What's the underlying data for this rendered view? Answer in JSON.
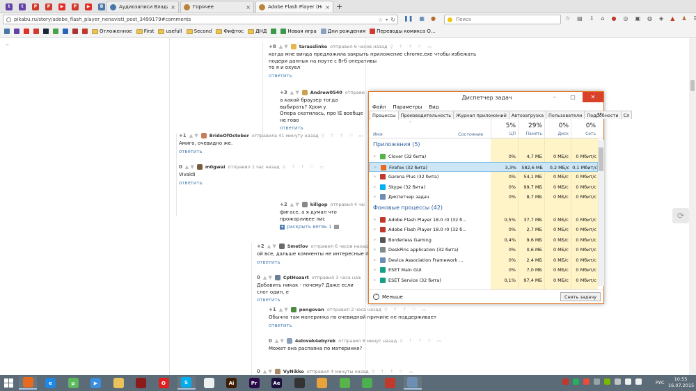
{
  "browser": {
    "pinned_tabs": [
      {
        "icon": "twitch-icon",
        "color": "#6441a5",
        "glyph": "t"
      },
      {
        "icon": "twitch-icon",
        "color": "#6441a5",
        "glyph": "t"
      },
      {
        "icon": "pikabu-icon",
        "color": "#d13b2f",
        "glyph": "P"
      },
      {
        "icon": "pikabu-icon",
        "color": "#d13b2f",
        "glyph": "P"
      },
      {
        "icon": "youtube-icon",
        "color": "#e52d27",
        "glyph": "▶"
      },
      {
        "icon": "pikabu-icon",
        "color": "#d13b2f",
        "glyph": "P"
      },
      {
        "icon": "youtube-icon",
        "color": "#e52d27",
        "glyph": "▶"
      },
      {
        "icon": "vk-icon",
        "color": "#4a76a8",
        "glyph": "В"
      }
    ],
    "tabs": [
      {
        "title": "Аудиозаписи Влада Перш...",
        "icon": "vk-icon",
        "color": "#4a76a8"
      },
      {
        "title": "Горячее",
        "icon": "pikabu-icon",
        "color": "#b9833a"
      },
      {
        "title": "Adobe Flash Player (Ненав...",
        "icon": "pikabu-icon",
        "color": "#b9833a"
      }
    ],
    "new_tab": "+",
    "close": "×",
    "url": "pikabu.ru/story/adobe_flash_player_nenavisti_post_3499179#comments",
    "search_placeholder": "Поиск",
    "bookmarks": [
      {
        "label": "",
        "icon": "vk-bookmark-icon",
        "color": "#4a76a8"
      },
      {
        "label": "",
        "icon": "twitch-bookmark-icon",
        "color": "#6441a5"
      },
      {
        "label": "",
        "icon": "youtube-bookmark-icon",
        "color": "#e52d27"
      },
      {
        "label": "",
        "icon": "pikabu-bookmark-icon",
        "color": "#d13b2f"
      },
      {
        "label": "",
        "icon": "steam-bookmark-icon",
        "color": "#1b2838"
      },
      {
        "label": "",
        "icon": "green-bookmark-icon",
        "color": "#4aa34a"
      },
      {
        "label": "",
        "icon": "mail-bookmark-icon",
        "color": "#2a63b8"
      },
      {
        "label": "",
        "icon": "game-bookmark-icon",
        "color": "#a33"
      },
      {
        "label": "",
        "icon": "red-bookmark-icon",
        "color": "#c0392b"
      },
      {
        "label": "Отложенное",
        "icon": "folder-icon"
      },
      {
        "label": "First",
        "icon": "folder-icon"
      },
      {
        "label": "usefull",
        "icon": "folder-icon"
      },
      {
        "label": "Second",
        "icon": "folder-icon"
      },
      {
        "label": "Фифтос",
        "icon": "folder-icon"
      },
      {
        "label": "ДНД",
        "icon": "folder-icon"
      },
      {
        "label": "",
        "icon": "green-grid-bookmark-icon",
        "color": "#3b9a4a"
      },
      {
        "label": "Новая игра",
        "icon": "green-grid-bookmark-icon",
        "color": "#3b9a4a"
      },
      {
        "label": "Дни рождения",
        "icon": "page-bookmark-icon",
        "color": "#8aa2c2"
      },
      {
        "label": "Переводы комикса О...",
        "icon": "pikabu-bookmark-icon",
        "color": "#d13b2f"
      }
    ]
  },
  "comments": [
    {
      "rating": "+8",
      "nick": "tarasslinko",
      "meta": "отправил 6 часов назад",
      "text": [
        "когда мне винда предложила закрыть приложение chrome.exe чтобы избежать",
        "подери данных на ноуте с 8гб оперативы",
        "то я и охуел"
      ],
      "reply": "ответить"
    },
    {
      "rating": "+3",
      "nick": "Andrew0540",
      "meta": "отправил 1 час н",
      "text": [
        "а какой браузер тогда выбирать? Хром у",
        "Опера скатилась, про IE вообще не гово"
      ],
      "reply": "ответить"
    },
    {
      "rating": "+1",
      "nick": "BrideOfOctober",
      "meta": "отправила 41 минуту назад",
      "text": [
        "Амиго, очевидно же."
      ],
      "reply": "ответить"
    },
    {
      "rating": "0",
      "nick": "m0gwai",
      "meta": "отправил 1 час назад",
      "text": [
        "Vivaldi"
      ],
      "reply": "ответить"
    },
    {
      "rating": "+2",
      "nick": "killgop",
      "meta": "отправил 4 часа назад",
      "text": [
        "фигасе, а я думал что прожорливее лис"
      ],
      "reply": "раскрыть ветвь 1"
    },
    {
      "rating": "+2",
      "nick": "Smetlov",
      "meta": "отправил 6 часов назад",
      "text": [
        "ой все, дальше комменты не интересные пошли."
      ],
      "reply": "ответить"
    },
    {
      "rating": "0",
      "nick": "CptHozart",
      "meta": "отправил 3 часа назад",
      "text": [
        "Добавить никак - почему? Даже если слот один, е"
      ],
      "reply": "ответить"
    },
    {
      "rating": "+1",
      "nick": "pengovan",
      "meta": "отправил 2 часа назад",
      "text": [
        "Обычно там материнка по очевидной причине не поддерживает"
      ],
      "reply": "ответить"
    },
    {
      "rating": "0",
      "nick": "4elovek4ebyrek",
      "meta": "отправил 8 минут назад",
      "text": [
        "Может она распаяна по материнке?"
      ],
      "reply": ""
    },
    {
      "rating": "0",
      "nick": "VyNikko",
      "meta": "отправил 4 минуты назад",
      "text": [],
      "reply": ""
    }
  ],
  "task_manager": {
    "title": "Диспетчер задач",
    "menu": [
      "Файл",
      "Параметры",
      "Вид"
    ],
    "tabs": [
      "Процессы",
      "Производительность",
      "Журнал приложений",
      "Автозагрузка",
      "Пользователи",
      "Подробности",
      "Сл"
    ],
    "columns": {
      "name": "Имя",
      "status": "Состояние",
      "cpu": {
        "pct": "5%",
        "label": "ЦП"
      },
      "mem": {
        "pct": "29%",
        "label": "Память"
      },
      "disk": {
        "pct": "0%",
        "label": "Диск"
      },
      "net": {
        "pct": "0%",
        "label": "Сеть"
      }
    },
    "groups": [
      {
        "title": "Приложения (5)",
        "rows": [
          {
            "name": "Clover (32 бита)",
            "icon": "clover-icon",
            "color": "#58b44a",
            "cpu": "0%",
            "mem": "4,7 МБ",
            "disk": "0 МБ/с",
            "net": "0 Мбит/с"
          },
          {
            "name": "Firefox (32 бита)",
            "icon": "firefox-icon",
            "color": "#e66a1f",
            "cpu": "3,3%",
            "mem": "582,6 МБ",
            "disk": "0,2 МБ/с",
            "net": "0,1 Мбит/с",
            "selected": true
          },
          {
            "name": "Garena Plus (32 бита)",
            "icon": "garena-icon",
            "color": "#c0392b",
            "cpu": "0%",
            "mem": "54,1 МБ",
            "disk": "0 МБ/с",
            "net": "0 Мбит/с"
          },
          {
            "name": "Skype (32 бита)",
            "icon": "skype-icon",
            "color": "#00aff0",
            "cpu": "0%",
            "mem": "99,7 МБ",
            "disk": "0 МБ/с",
            "net": "0 Мбит/с"
          },
          {
            "name": "Диспетчер задач",
            "icon": "taskmgr-icon",
            "color": "#6d8fb3",
            "cpu": "0%",
            "mem": "8,7 МБ",
            "disk": "0 МБ/с",
            "net": "0 Мбит/с"
          }
        ]
      },
      {
        "title": "Фоновые процессы (42)",
        "rows": [
          {
            "name": "Adobe Flash Player 18.0 r0 (32 б...",
            "icon": "flash-icon",
            "color": "#c0392b",
            "cpu": "0,5%",
            "mem": "37,7 МБ",
            "disk": "0 МБ/с",
            "net": "0 Мбит/с"
          },
          {
            "name": "Adobe Flash Player 18.0 r0 (32 б...",
            "icon": "flash-icon",
            "color": "#c0392b",
            "cpu": "0%",
            "mem": "2,7 МБ",
            "disk": "0 МБ/с",
            "net": "0 Мбит/с"
          },
          {
            "name": "Borderless Gaming",
            "icon": "gaming-icon",
            "color": "#555555",
            "cpu": "0,4%",
            "mem": "9,6 МБ",
            "disk": "0 МБ/с",
            "net": "0 Мбит/с"
          },
          {
            "name": "DeskPins application (32 бита)",
            "icon": "pin-icon",
            "color": "#7f8c8d",
            "cpu": "0%",
            "mem": "0,6 МБ",
            "disk": "0 МБ/с",
            "net": "0 Мбит/с"
          },
          {
            "name": "Device Association Framework ...",
            "icon": "device-icon",
            "color": "#6d8fb3",
            "cpu": "0%",
            "mem": "2,4 МБ",
            "disk": "0 МБ/с",
            "net": "0 Мбит/с"
          },
          {
            "name": "ESET Main GUI",
            "icon": "eset-icon",
            "color": "#16a085",
            "cpu": "0%",
            "mem": "7,0 МБ",
            "disk": "0 МБ/с",
            "net": "0 Мбит/с"
          },
          {
            "name": "ESET Service (32 бита)",
            "icon": "eset-icon",
            "color": "#16a085",
            "cpu": "0,1%",
            "mem": "97,4 МБ",
            "disk": "0 МБ/с",
            "net": "0 Мбит/с"
          }
        ]
      }
    ],
    "fewer_label": "Меньше",
    "end_task_label": "Снять задачу"
  },
  "taskbar": {
    "apps": [
      {
        "icon": "firefox-icon",
        "color": "#e66a1f",
        "glyph": "",
        "open": true
      },
      {
        "icon": "ie-icon",
        "color": "#1e88e5",
        "glyph": "e",
        "open": false
      },
      {
        "icon": "utorrent-icon",
        "color": "#5cb85c",
        "glyph": "µ",
        "open": false
      },
      {
        "icon": "media-player-icon",
        "color": "#3b8ee0",
        "glyph": "▶",
        "open": false
      },
      {
        "icon": "explorer-icon",
        "color": "#e8c25a",
        "glyph": "",
        "open": false
      },
      {
        "icon": "dota-icon",
        "color": "#8b1a1a",
        "glyph": "",
        "open": false
      },
      {
        "icon": "opera-icon",
        "color": "#e02020",
        "glyph": "O",
        "open": false
      },
      {
        "icon": "skype-icon",
        "color": "#00aff0",
        "glyph": "S",
        "open": true
      },
      {
        "icon": "cat-icon",
        "color": "#ecf0f1",
        "glyph": "",
        "open": false
      },
      {
        "icon": "illustrator-icon",
        "color": "#3d1c02",
        "glyph": "Ai",
        "open": false
      },
      {
        "icon": "premiere-icon",
        "color": "#2a0a48",
        "glyph": "Pr",
        "open": false
      },
      {
        "icon": "after-effects-icon",
        "color": "#1a0f3d",
        "glyph": "Ae",
        "open": false
      },
      {
        "icon": "video-icon",
        "color": "#333333",
        "glyph": "",
        "open": false
      },
      {
        "icon": "paint-icon",
        "color": "#e8a33d",
        "glyph": "",
        "open": false
      },
      {
        "icon": "clover-icon",
        "color": "#58b44a",
        "glyph": "",
        "open": false
      },
      {
        "icon": "chrome-icon",
        "color": "#4caf50",
        "glyph": "",
        "open": false
      },
      {
        "icon": "garena-icon",
        "color": "#c0392b",
        "glyph": "",
        "open": false
      },
      {
        "icon": "taskmgr-icon",
        "color": "#6d8fb3",
        "glyph": "",
        "open": true
      }
    ],
    "tray_icons": [
      {
        "icon": "tray-bug-icon",
        "color": "#c0392b"
      },
      {
        "icon": "tray-green-icon",
        "color": "#27ae60"
      },
      {
        "icon": "tray-red-icon",
        "color": "#e74c3c"
      },
      {
        "icon": "tray-gray-icon",
        "color": "#95a5a6"
      },
      {
        "icon": "tray-nvidia-icon",
        "color": "#76b900"
      },
      {
        "icon": "tray-pin-icon",
        "color": "#bdc3c7"
      },
      {
        "icon": "tray-network-icon",
        "color": "#ecf0f1"
      },
      {
        "icon": "tray-volume-icon",
        "color": "#ecf0f1"
      }
    ],
    "lang": "РУС",
    "time": "10:55",
    "date": "16.07.2015"
  }
}
